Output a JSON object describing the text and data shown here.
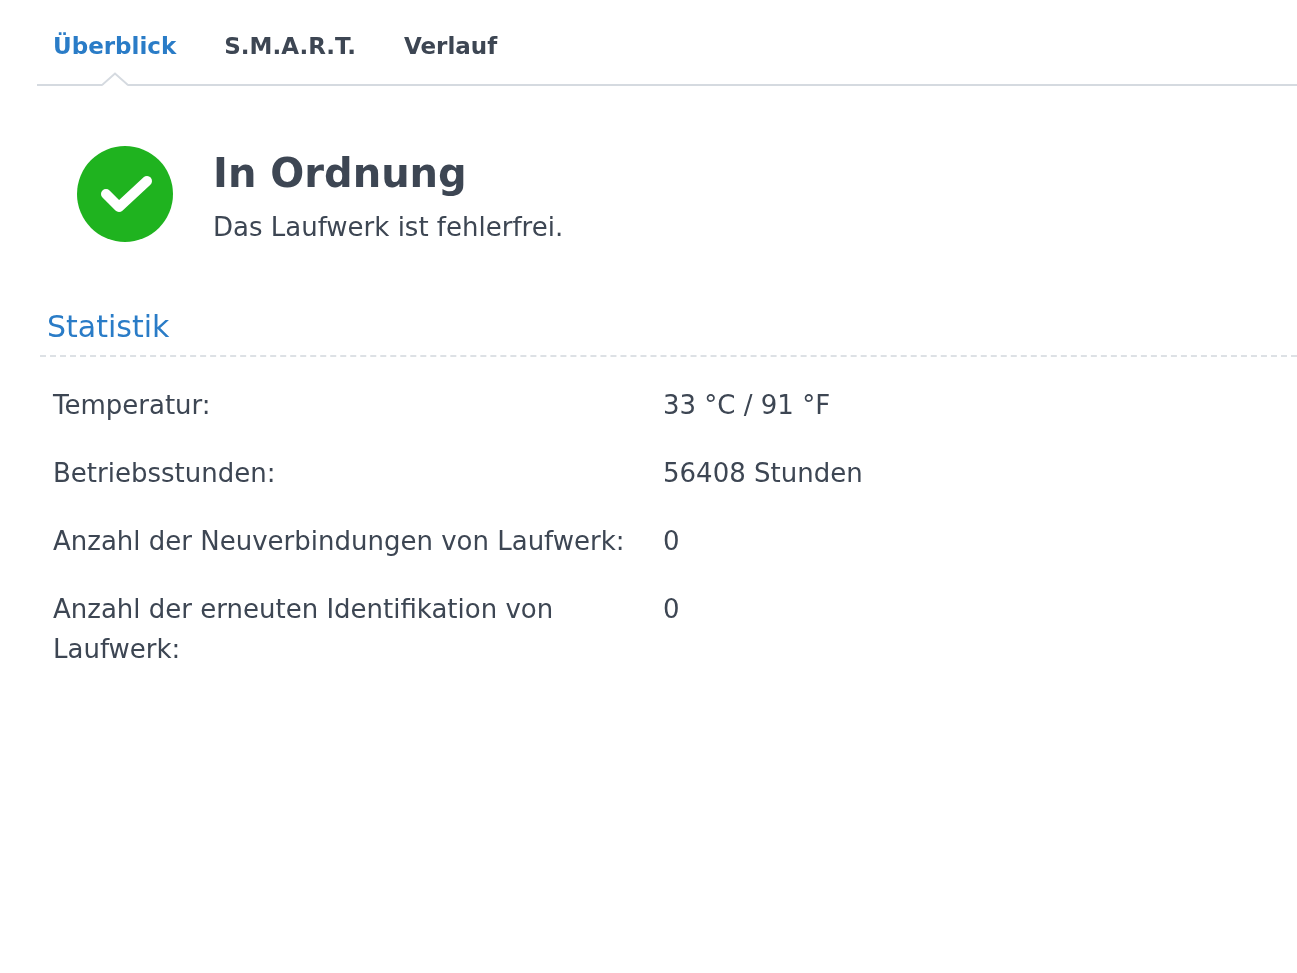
{
  "tabs": [
    {
      "label": "Überblick",
      "selected": true
    },
    {
      "label": "S.M.A.R.T.",
      "selected": false
    },
    {
      "label": "Verlauf",
      "selected": false
    }
  ],
  "status": {
    "kind": "ok",
    "title": "In Ordnung",
    "message": "Das Laufwerk ist fehlerfrei."
  },
  "statistics": {
    "title": "Statistik",
    "rows": [
      {
        "label": "Temperatur:",
        "value": "33 °C / 91 °F"
      },
      {
        "label": "Betriebsstunden:",
        "value": "56408 Stunden"
      },
      {
        "label": "Anzahl der Neuverbindungen von Laufwerk:",
        "value": "0"
      },
      {
        "label": "Anzahl der erneuten Identifikation von Laufwerk:",
        "value": "0"
      }
    ]
  }
}
